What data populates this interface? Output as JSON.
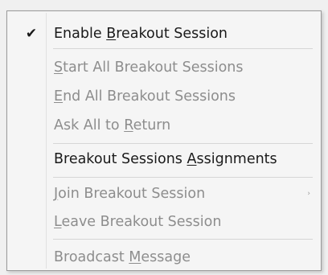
{
  "menu": {
    "items": [
      {
        "pre": "Enable ",
        "key": "B",
        "post": "reakout Session",
        "checked": true,
        "enabled": true,
        "checkmark": "✔"
      },
      {
        "pre": "",
        "key": "S",
        "post": "tart All Breakout Sessions",
        "enabled": false
      },
      {
        "pre": "",
        "key": "E",
        "post": "nd All Breakout Sessions",
        "enabled": false
      },
      {
        "pre": "Ask All to ",
        "key": "R",
        "post": "eturn",
        "enabled": false
      },
      {
        "pre": "Breakout Sessions ",
        "key": "A",
        "post": "ssignments",
        "enabled": true
      },
      {
        "pre": "",
        "key": "J",
        "post": "oin Breakout Session",
        "enabled": false,
        "submenu_arrow": "›"
      },
      {
        "pre": "",
        "key": "L",
        "post": "eave Breakout Session",
        "enabled": false
      },
      {
        "pre": "Broadcast ",
        "key": "M",
        "post": "essage",
        "enabled": false
      }
    ]
  },
  "colors": {
    "menu_background": "#f5f5f5",
    "enabled_text": "#1a1a1a",
    "disabled_text": "#8d8d8d",
    "separator": "#d6d6d6",
    "border": "#9a9a9a"
  },
  "icons": {
    "checkmark": "check-icon",
    "submenu": "chevron-right-icon"
  }
}
